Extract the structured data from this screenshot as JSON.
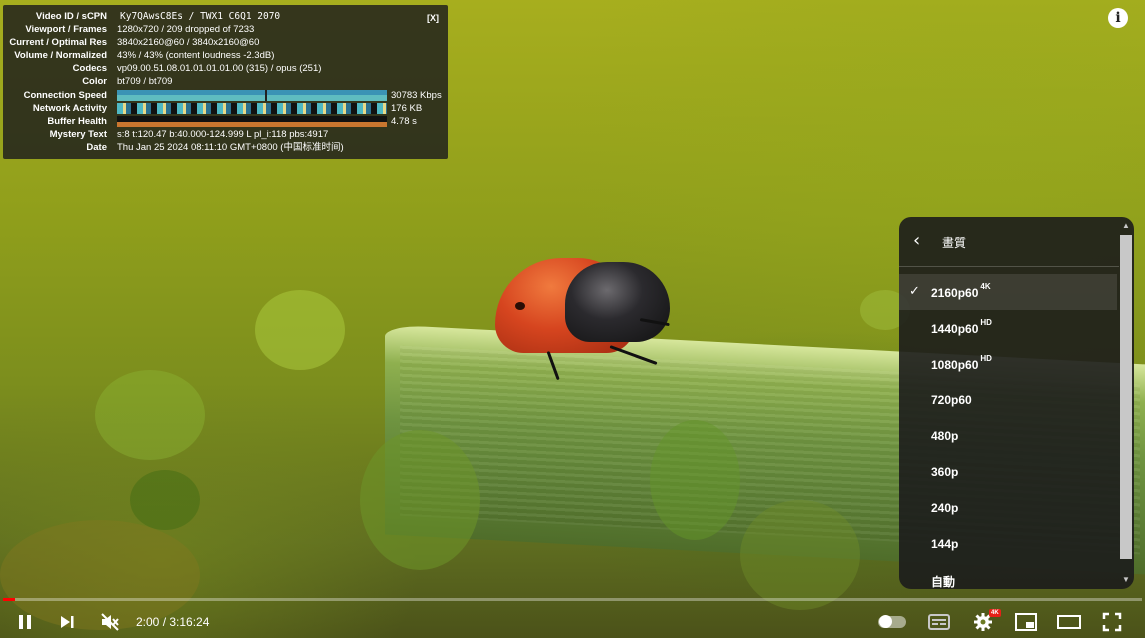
{
  "stats": {
    "close": "[X]",
    "rows": [
      {
        "key": "Video ID / sCPN",
        "value": "Ky7QAwsC8Es / TWX1 C6Q1 2070"
      },
      {
        "key": "Viewport / Frames",
        "value": "1280x720 / 209 dropped of 7233"
      },
      {
        "key": "Current / Optimal Res",
        "value": "3840x2160@60 / 3840x2160@60"
      },
      {
        "key": "Volume / Normalized",
        "value": "43% / 43% (content loudness -2.3dB)"
      },
      {
        "key": "Codecs",
        "value": "vp09.00.51.08.01.01.01.01.00 (315) / opus (251)"
      },
      {
        "key": "Color",
        "value": "bt709 / bt709"
      },
      {
        "key": "Connection Speed",
        "value": "30783 Kbps"
      },
      {
        "key": "Network Activity",
        "value": "176 KB"
      },
      {
        "key": "Buffer Health",
        "value": "4.78 s"
      },
      {
        "key": "Mystery Text",
        "value": "s:8 t:120.47 b:40.000-124.999 L pl_i:118 pbs:4917"
      },
      {
        "key": "Date",
        "value": "Thu Jan 25 2024 08:11:10 GMT+0800 (中国标准时间)"
      }
    ]
  },
  "info_icon": "i",
  "quality_menu": {
    "back_icon": "‹",
    "title": "畫質",
    "selected_mark": "✓",
    "options": [
      {
        "label": "2160p60",
        "badge": "4K",
        "selected": true
      },
      {
        "label": "1440p60",
        "badge": "HD",
        "selected": false
      },
      {
        "label": "1080p60",
        "badge": "HD",
        "selected": false
      },
      {
        "label": "720p60",
        "badge": "",
        "selected": false
      },
      {
        "label": "480p",
        "badge": "",
        "selected": false
      },
      {
        "label": "360p",
        "badge": "",
        "selected": false
      },
      {
        "label": "240p",
        "badge": "",
        "selected": false
      },
      {
        "label": "144p",
        "badge": "",
        "selected": false
      },
      {
        "label": "自動",
        "badge": "",
        "selected": false
      }
    ]
  },
  "player": {
    "time": "2:00 / 3:16:24",
    "progress_fraction": 0.0102,
    "settings_badge": "4K",
    "accent_color": "#ff0000"
  }
}
